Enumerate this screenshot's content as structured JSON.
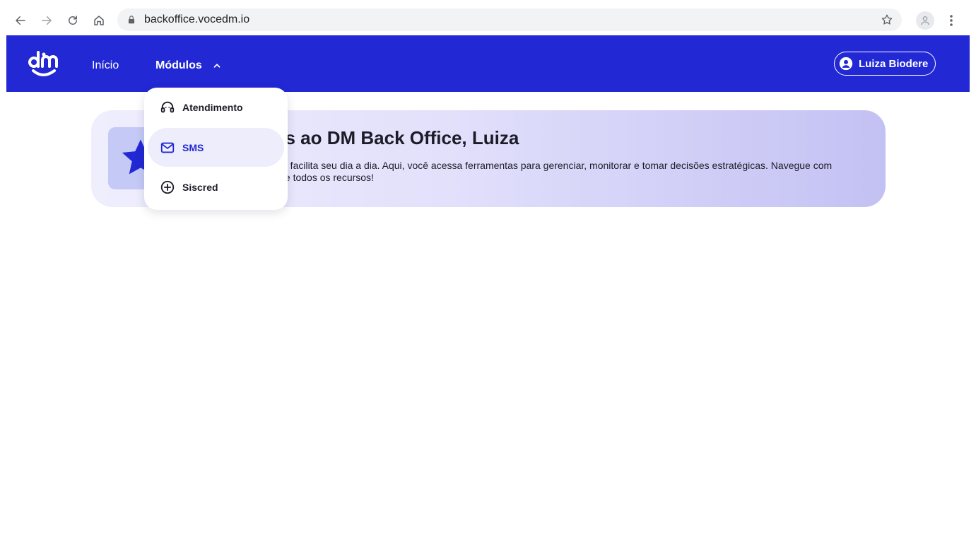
{
  "browser": {
    "url": "backoffice.vocedm.io",
    "icons": {
      "back": "arrow-left-icon",
      "forward": "arrow-right-icon",
      "reload": "reload-icon",
      "home": "home-icon",
      "lock": "lock-icon",
      "bookmark": "star-outline-icon",
      "profile": "profile-icon",
      "menu": "kebab-menu-icon"
    }
  },
  "header": {
    "brand_color": "#2128d4",
    "nav": {
      "inicio_label": "Início",
      "modulos_label": "Módulos"
    },
    "user": {
      "name": "Luiza Biodere"
    }
  },
  "modules_menu": {
    "items": [
      {
        "label": "Atendimento",
        "icon": "headset-icon",
        "active": false
      },
      {
        "label": "SMS",
        "icon": "mail-icon",
        "active": true
      },
      {
        "label": "Siscred",
        "icon": "plus-circle-icon",
        "active": false
      }
    ]
  },
  "banner": {
    "title_visible": "as ao DM Back Office, Luiza",
    "text_line1": "e facilita seu dia a dia. Aqui, você acessa ferramentas para gerenciar, monitorar e tomar decisões estratégicas. Navegue com",
    "text_line2": "te todos os recursos!",
    "icon": "star-icon"
  }
}
